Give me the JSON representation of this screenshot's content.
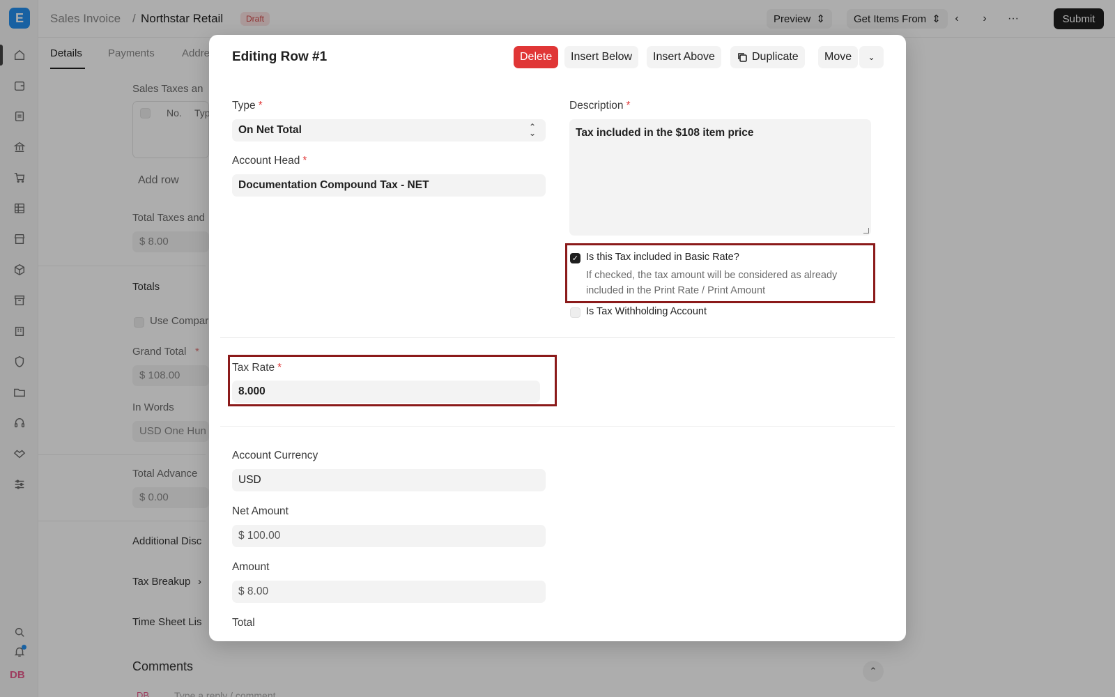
{
  "app": {
    "logo_letter": "E",
    "avatar_initials": "DB"
  },
  "header": {
    "breadcrumb_root": "Sales Invoice",
    "separator": "/",
    "breadcrumb_current": "Northstar Retail",
    "status_badge": "Draft",
    "preview_label": "Preview",
    "get_items_label": "Get Items From",
    "submit_label": "Submit"
  },
  "tabs": [
    "Details",
    "Payments",
    "Address"
  ],
  "background_form": {
    "sales_taxes_label": "Sales Taxes an",
    "table_no_col": "No.",
    "table_type_col": "Typ",
    "add_row_label": "Add row",
    "total_taxes_label": "Total Taxes and",
    "total_taxes_value": "$ 8.00",
    "totals_section": "Totals",
    "use_company_label": "Use Compar",
    "grand_total_label": "Grand Total",
    "grand_total_value": "$ 108.00",
    "in_words_label": "In Words",
    "in_words_value": "USD One Hun",
    "total_advance_label": "Total Advance",
    "total_advance_value": "$ 0.00",
    "additional_discount_section": "Additional Disc",
    "tax_breakup_section": "Tax Breakup",
    "time_sheet_section": "Time Sheet Lis",
    "comments_section": "Comments",
    "comment_placeholder": "Type a reply / comment"
  },
  "modal": {
    "title": "Editing Row #1",
    "actions": {
      "delete": "Delete",
      "insert_below": "Insert Below",
      "insert_above": "Insert Above",
      "duplicate": "Duplicate",
      "move": "Move"
    },
    "type": {
      "label": "Type",
      "value": "On Net Total"
    },
    "account_head": {
      "label": "Account Head",
      "value": "Documentation Compound Tax - NET"
    },
    "description": {
      "label": "Description",
      "value": "Tax included in the $108 item price"
    },
    "included_in_basic_rate": {
      "label": "Is this Tax included in Basic Rate?",
      "help": "If checked, the tax amount will be considered as already included in the Print Rate / Print Amount",
      "checked": true
    },
    "tax_withholding": {
      "label": "Is Tax Withholding Account",
      "checked": false
    },
    "tax_rate": {
      "label": "Tax Rate",
      "value": "8.000"
    },
    "account_currency": {
      "label": "Account Currency",
      "value": "USD"
    },
    "net_amount": {
      "label": "Net Amount",
      "value": "$ 100.00"
    },
    "amount": {
      "label": "Amount",
      "value": "$ 8.00"
    },
    "total": {
      "label": "Total"
    }
  },
  "colors": {
    "danger": "#e03636",
    "highlight": "#8b1a1a",
    "draft_badge": "#d24a4a"
  }
}
